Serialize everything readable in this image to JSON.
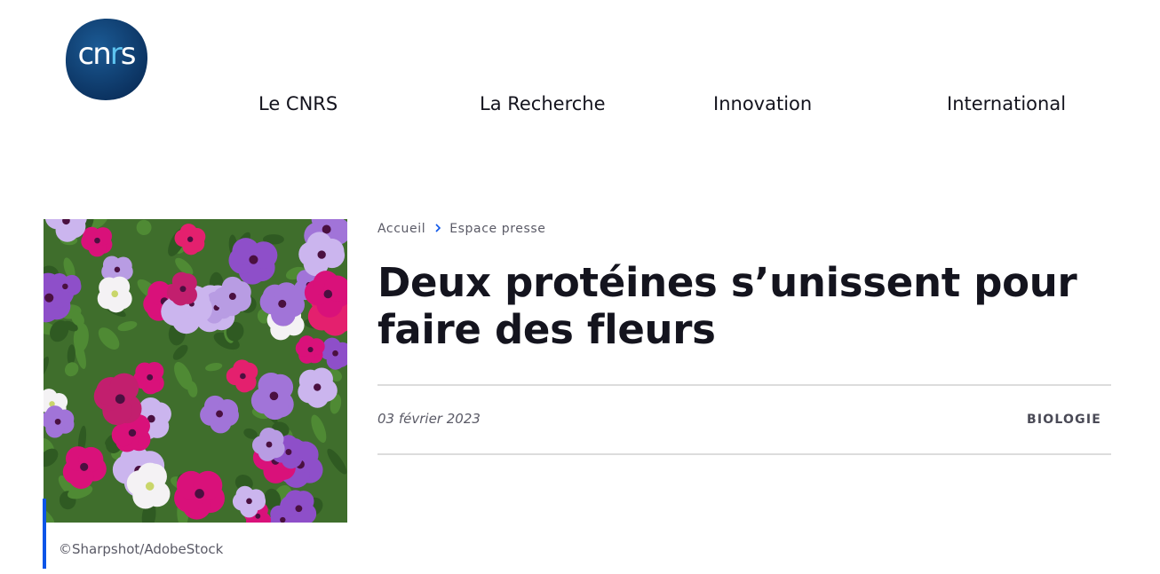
{
  "header": {
    "logo_text": "cnrs",
    "nav": [
      "Le CNRS",
      "La Recherche",
      "Innovation",
      "International"
    ]
  },
  "article": {
    "image_credit": "©Sharpshot/AdobeStock",
    "breadcrumb": [
      "Accueil",
      "Espace presse"
    ],
    "title": "Deux protéines s’unissent pour faire des fleurs",
    "date": "03 février 2023",
    "category": "BIOLOGIE"
  },
  "colors": {
    "accent": "#0c55e8",
    "logo_bg": "#0d3b6e",
    "text": "#14141e"
  }
}
